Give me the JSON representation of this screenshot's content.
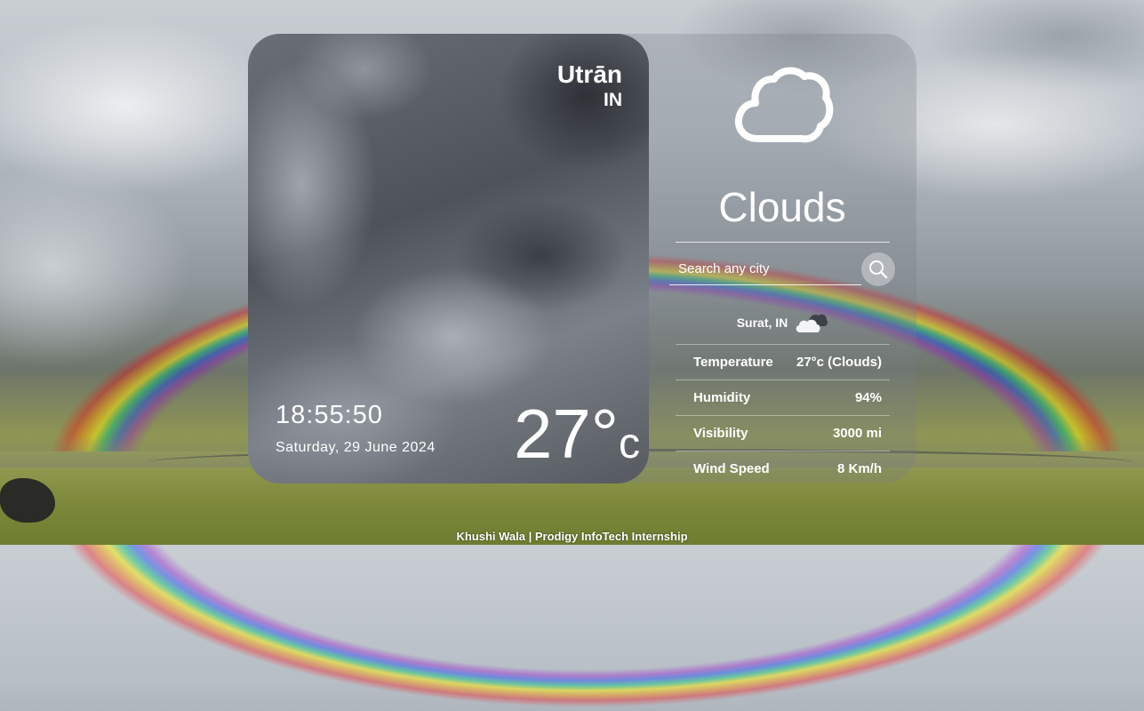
{
  "location": {
    "city": "Utrān",
    "country": "IN"
  },
  "clock": {
    "time": "18:55:50",
    "date": "Saturday, 29 June 2024"
  },
  "current": {
    "temperature": "27°",
    "unit": "c",
    "condition": "Clouds",
    "icon": "cloud-icon"
  },
  "search": {
    "placeholder": "Search any city"
  },
  "result": {
    "location": "Surat, IN",
    "icon": "cloudy-icon",
    "rows": [
      {
        "label": "Temperature",
        "value": "27°c (Clouds)"
      },
      {
        "label": "Humidity",
        "value": "94%"
      },
      {
        "label": "Visibility",
        "value": "3000 mi"
      },
      {
        "label": "Wind Speed",
        "value": "8 Km/h"
      }
    ]
  },
  "footer": {
    "text": "Khushi Wala | Prodigy InfoTech Internship"
  }
}
